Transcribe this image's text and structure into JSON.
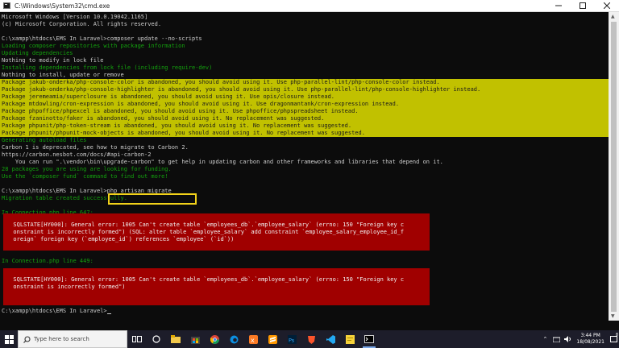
{
  "window": {
    "title": "C:\\Windows\\System32\\cmd.exe",
    "minimize_icon": "minimize-icon",
    "maximize_icon": "maximize-icon",
    "close_icon": "close-icon"
  },
  "console": {
    "lines": [
      {
        "text": "Microsoft Windows [Version 10.0.19042.1165]",
        "style": "w"
      },
      {
        "text": "(c) Microsoft Corporation. All rights reserved.",
        "style": "w"
      },
      {
        "text": "",
        "style": "w"
      },
      {
        "text": "C:\\xampp\\htdocs\\EMS In Laravel>composer update --no-scripts",
        "style": "w"
      },
      {
        "text": "Loading composer repositories with package information",
        "style": "g"
      },
      {
        "text": "Updating dependencies",
        "style": "g"
      },
      {
        "text": "Nothing to modify in lock file",
        "style": "w"
      },
      {
        "text": "Installing dependencies from lock file (including require-dev)",
        "style": "g"
      },
      {
        "text": "Nothing to install, update or remove",
        "style": "w"
      },
      {
        "text": "Package jakub-onderka/php-console-color is abandoned, you should avoid using it. Use php-parallel-lint/php-console-color instead.",
        "style": "y"
      },
      {
        "text": "Package jakub-onderka/php-console-highlighter is abandoned, you should avoid using it. Use php-parallel-lint/php-console-highlighter instead.",
        "style": "y"
      },
      {
        "text": "Package jeremeamia/superclosure is abandoned, you should avoid using it. Use opis/closure instead.",
        "style": "y"
      },
      {
        "text": "Package mtdowling/cron-expression is abandoned, you should avoid using it. Use dragonmantank/cron-expression instead.",
        "style": "y"
      },
      {
        "text": "Package phpoffice/phpexcel is abandoned, you should avoid using it. Use phpoffice/phpspreadsheet instead.",
        "style": "y"
      },
      {
        "text": "Package fzaninotto/faker is abandoned, you should avoid using it. No replacement was suggested.",
        "style": "y"
      },
      {
        "text": "Package phpunit/php-token-stream is abandoned, you should avoid using it. No replacement was suggested.",
        "style": "y"
      },
      {
        "text": "Package phpunit/phpunit-mock-objects is abandoned, you should avoid using it. No replacement was suggested.",
        "style": "y"
      },
      {
        "text": "Generating autoload files",
        "style": "g"
      },
      {
        "text": "Carbon 1 is deprecated, see how to migrate to Carbon 2.",
        "style": "w"
      },
      {
        "text": "https://carbon.nesbot.com/docs/#api-carbon-2",
        "style": "w"
      },
      {
        "text": "    You can run \".\\vendor\\bin\\upgrade-carbon\" to get help in updating carbon and other frameworks and libraries that depend on it.",
        "style": "w"
      },
      {
        "text": "28 packages you are using are looking for funding.",
        "style": "g"
      },
      {
        "text": "Use the `composer fund` command to find out more!",
        "style": "g"
      },
      {
        "text": "",
        "style": "w"
      },
      {
        "text": "C:\\xampp\\htdocs\\EMS In Laravel>php artisan migrate",
        "style": "w"
      },
      {
        "text": "Migration table created successfully.",
        "style": "g"
      },
      {
        "text": "",
        "style": "w"
      },
      {
        "text": "In Connection.php line 647:",
        "style": "g"
      }
    ],
    "error1": [
      "",
      "  SQLSTATE[HY000]: General error: 1005 Can't create table `employees_db`.`employee_salary` (errno: 150 \"Foreign key c",
      "  onstraint is incorrectly formed\") (SQL: alter table `employee_salary` add constraint `employee_salary_employee_id_f",
      "  oreign` foreign key (`employee_id`) references `employee` (`id`))",
      ""
    ],
    "in_line_449": "In Connection.php line 449:",
    "error2": [
      "",
      "  SQLSTATE[HY000]: General error: 1005 Can't create table `employees_db`.`employee_salary` (errno: 150 \"Foreign key c",
      "  onstraint is incorrectly formed\")",
      ""
    ],
    "prompt": "C:\\xampp\\htdocs\\EMS In Laravel>"
  },
  "taskbar": {
    "search_placeholder": "Type here to search",
    "time": "3:44 PM",
    "date": "18/08/2021",
    "notification_count": "8"
  },
  "colors": {
    "console_bg": "#0c0c0c",
    "green": "#13a10e",
    "warning_bg": "#c1c100",
    "error_bg": "#a00000",
    "highlight": "#f2d21a"
  }
}
